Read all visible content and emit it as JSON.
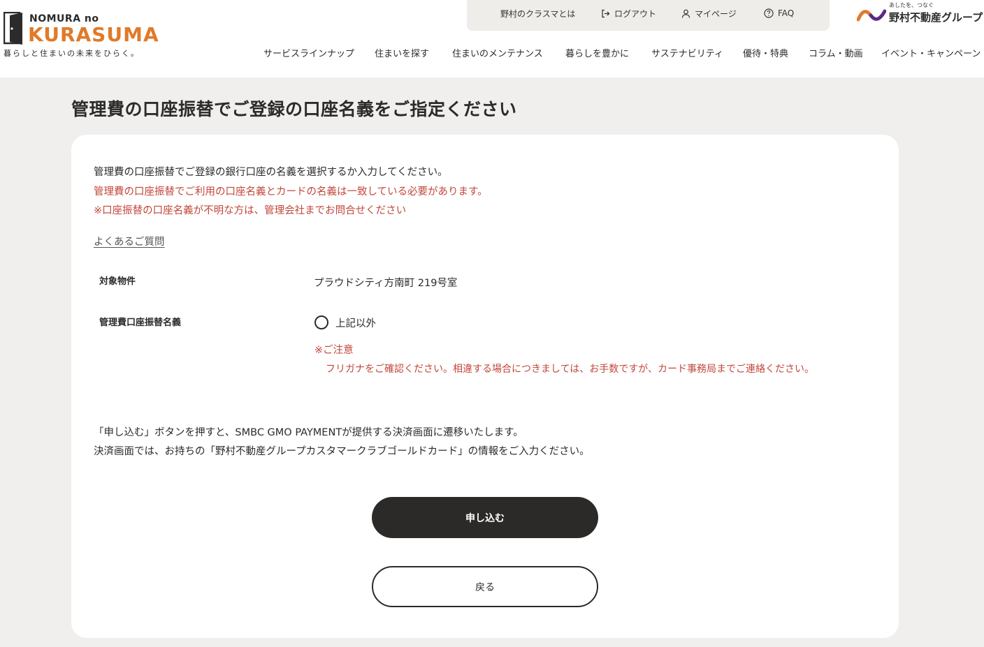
{
  "logo": {
    "line1": "NOMURA no",
    "line2": "KURASUMA",
    "tagline": "暮らしと住まいの未来をひらく。"
  },
  "util_nav": {
    "about": "野村のクラスマとは",
    "logout": "ログアウト",
    "mypage": "マイページ",
    "faq": "FAQ"
  },
  "brand": {
    "tagline": "あしたを、つなぐ",
    "name": "野村不動産グループ"
  },
  "nav": [
    "サービスラインナップ",
    "住まいを探す",
    "住まいのメンテナンス",
    "暮らしを豊かに",
    "サステナビリティ",
    "優待・特典",
    "コラム・動画",
    "イベント・キャンペーン"
  ],
  "page": {
    "title": "管理費の口座振替でご登録の口座名義をご指定ください"
  },
  "intro": {
    "line1": "管理費の口座振替でご登録の銀行口座の名義を選択するか入力してください。",
    "line2": "管理費の口座振替でご利用の口座名義とカードの名義は一致している必要があります。",
    "line3": "※口座振替の口座名義が不明な方は、管理会社までお問合せください",
    "faq_link": "よくあるご質問"
  },
  "form": {
    "property_label": "対象物件",
    "property_value": "プラウドシティ方南町 219号室",
    "holder_label": "管理費口座振替名義",
    "radio_option": "上記以外",
    "radio_checked": false,
    "note_title": "※ご注意",
    "note_body": "フリガナをご確認ください。相違する場合につきましては、お手数ですが、カード事務局までご連絡ください。"
  },
  "info": {
    "line1": "「申し込む」ボタンを押すと、SMBC GMO PAYMENTが提供する決済画面に遷移いたします。",
    "line2": "決済画面では、お持ちの「野村不動産グループカスタマークラブゴールドカード」の情報をご入力ください。"
  },
  "buttons": {
    "submit": "申し込む",
    "back": "戻る"
  },
  "colors": {
    "accent_orange": "#e07a2a",
    "brand_purple": "#5b2a86",
    "warning_red": "#c2473a",
    "button_dark": "#2b2a29",
    "page_bg": "#f0efed"
  }
}
